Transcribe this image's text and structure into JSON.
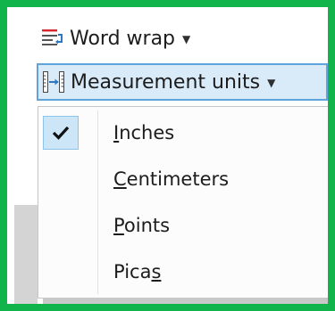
{
  "ribbon": {
    "word_wrap": {
      "label": "Word wrap",
      "icon": "word-wrap-icon"
    },
    "measurement_units": {
      "label": "Measurement units",
      "icon": "measurement-units-icon"
    }
  },
  "menu": {
    "items": [
      {
        "pre": "",
        "accel": "I",
        "post": "nches",
        "checked": true
      },
      {
        "pre": "",
        "accel": "C",
        "post": "entimeters",
        "checked": false
      },
      {
        "pre": "",
        "accel": "P",
        "post": "oints",
        "checked": false
      },
      {
        "pre": "Pica",
        "accel": "s",
        "post": "",
        "checked": false
      }
    ]
  },
  "colors": {
    "frame_border": "#10b44a",
    "hover_bg": "#d9eaf9",
    "hover_border": "#5fa3dd",
    "check_bg": "#cde6f7"
  }
}
